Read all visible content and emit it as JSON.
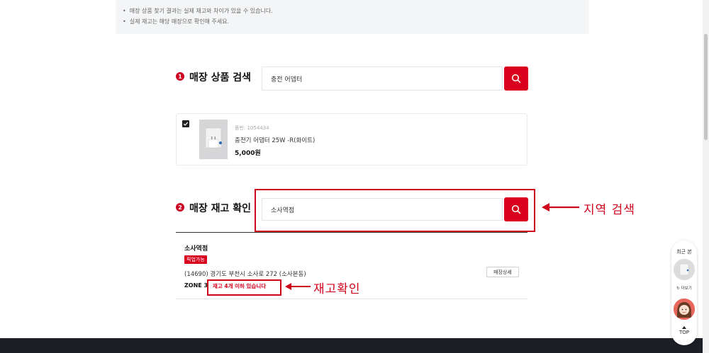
{
  "notice": {
    "lines": [
      "매장 상품 찾기 결과는 실제 재고와 차이가 있을 수 있습니다.",
      "실제 재고는 해당 매장으로 확인해 주세요."
    ]
  },
  "step1": {
    "number": "1",
    "title": "매장 상품 검색",
    "search_value": "충전 어뎁터"
  },
  "product": {
    "checked": true,
    "code": "품번: 1054434",
    "name": "충전기 어댑터 25W -R(화이트)",
    "price": "5,000원"
  },
  "step2": {
    "number": "2",
    "title": "매장 재고 확인",
    "search_value": "소사역점",
    "annotation": "지역 검색"
  },
  "store": {
    "name": "소사역점",
    "badge": "픽업가능",
    "address": "(14690) 경기도 부천시 소사로 272 (소사본동)",
    "zone": "ZONE 3",
    "stock": "재고 4개 이하 있습니다",
    "detail_button": "매장상세",
    "annotation": "재고확인"
  },
  "quick": {
    "recent_label": "최근 본",
    "more_label": "더보기",
    "top_label": "TOP"
  },
  "colors": {
    "accent": "#d8001c",
    "annotation": "#d0021b",
    "footer": "#1c1f26"
  }
}
